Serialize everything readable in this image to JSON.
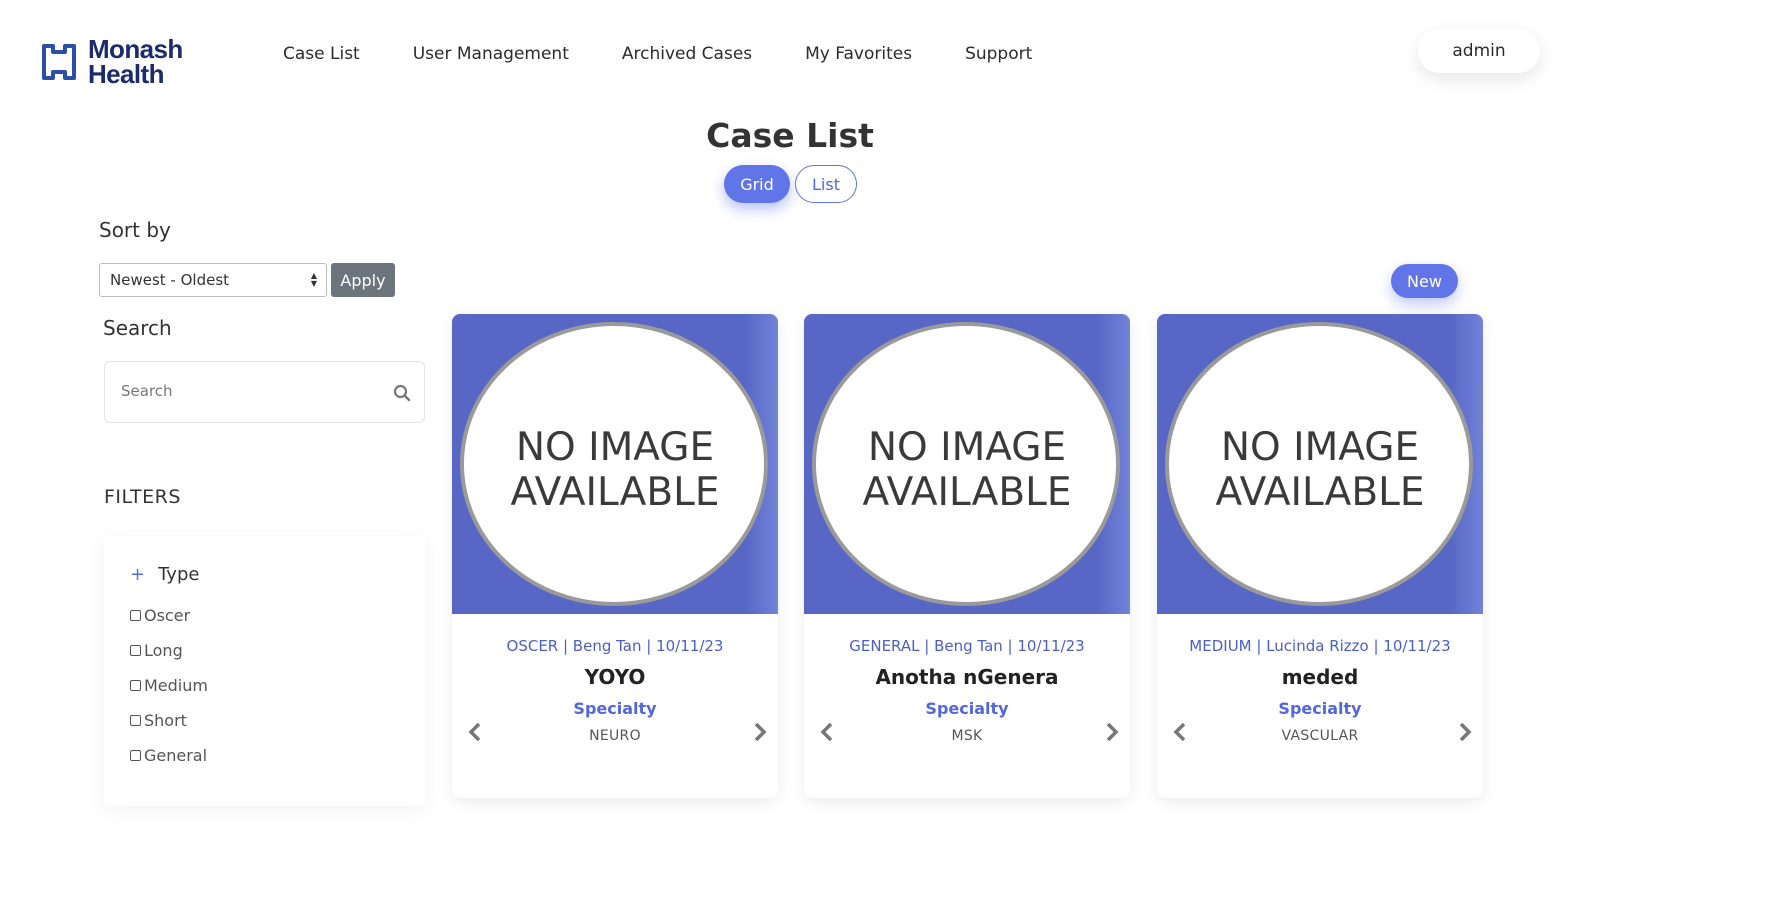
{
  "brand": {
    "line1": "Monash",
    "line2": "Health"
  },
  "nav": [
    {
      "label": "Case List"
    },
    {
      "label": "User Management"
    },
    {
      "label": "Archived Cases"
    },
    {
      "label": "My Favorites"
    },
    {
      "label": "Support"
    }
  ],
  "user": {
    "label": "admin"
  },
  "page": {
    "title": "Case List"
  },
  "view_toggle": {
    "grid": "Grid",
    "list": "List",
    "selected": "Grid"
  },
  "sidebar": {
    "sort_label": "Sort by",
    "sort_value": "Newest - Oldest",
    "apply_label": "Apply",
    "search_label": "Search",
    "search_placeholder": "Search",
    "filters_label": "FILTERS",
    "type_label": "Type",
    "type_options": [
      "Oscer",
      "Long",
      "Medium",
      "Short",
      "General"
    ]
  },
  "new_label": "New",
  "cards": [
    {
      "image_text1": "NO IMAGE",
      "image_text2": "AVAILABLE",
      "meta": "OSCER |  Beng Tan |  10/11/23",
      "title": "YOYO",
      "spec_label": "Specialty",
      "spec_value": "NEURO"
    },
    {
      "image_text1": "NO IMAGE",
      "image_text2": "AVAILABLE",
      "meta": "GENERAL |  Beng Tan |  10/11/23",
      "title": "Anotha nGenera",
      "spec_label": "Specialty",
      "spec_value": "MSK"
    },
    {
      "image_text1": "NO IMAGE",
      "image_text2": "AVAILABLE",
      "meta": "MEDIUM |  Lucinda Rizzo |  10/11/23",
      "title": "meded",
      "spec_label": "Specialty",
      "spec_value": "VASCULAR"
    }
  ],
  "colors": {
    "accent": "#6174e8",
    "card_image_bg": "#5867c6",
    "brand_navy": "#1d2a6b",
    "apply_gray": "#6c757d"
  }
}
